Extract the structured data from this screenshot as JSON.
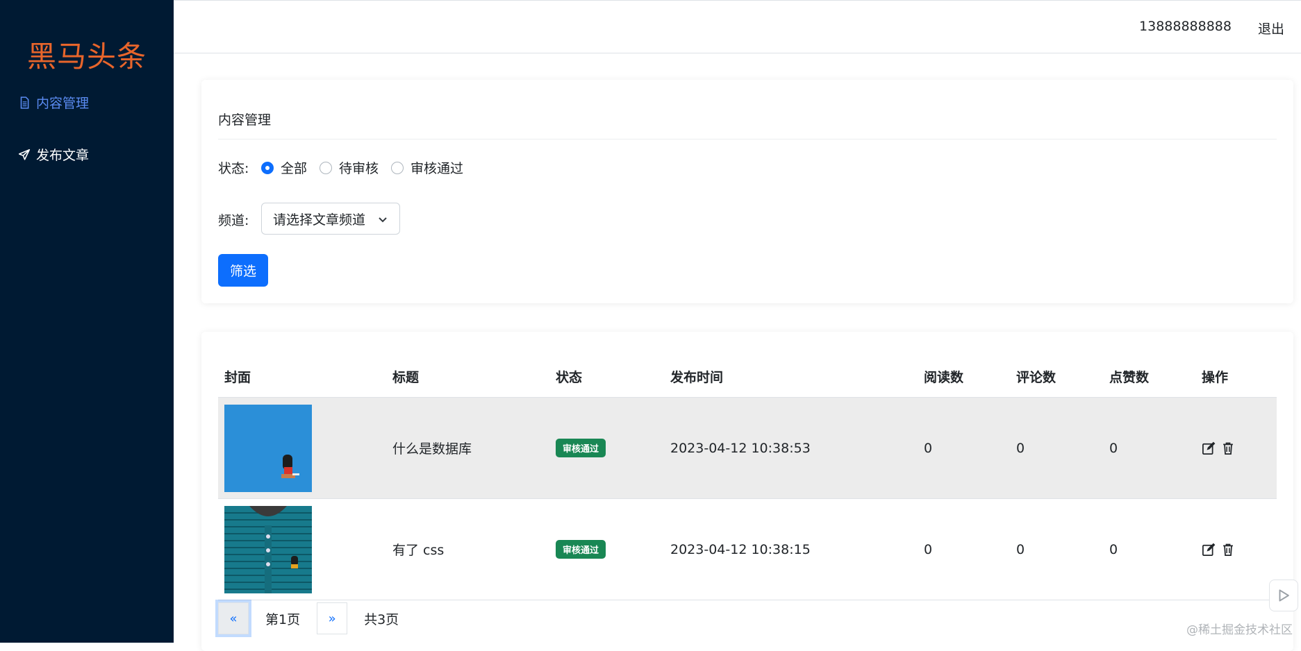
{
  "sidebar": {
    "logo": "黑马头条",
    "items": [
      {
        "label": "内容管理",
        "icon": "document-icon",
        "active": true
      },
      {
        "label": "发布文章",
        "icon": "send-icon",
        "active": false
      }
    ]
  },
  "topbar": {
    "phone": "13888888888",
    "logout": "退出"
  },
  "filter": {
    "title": "内容管理",
    "status_label": "状态:",
    "status_options": [
      {
        "label": "全部",
        "checked": true
      },
      {
        "label": "待审核",
        "checked": false
      },
      {
        "label": "审核通过",
        "checked": false
      }
    ],
    "channel_label": "频道:",
    "channel_select": "请选择文章频道",
    "submit_label": "筛选"
  },
  "table": {
    "headers": [
      "封面",
      "标题",
      "状态",
      "发布时间",
      "阅读数",
      "评论数",
      "点赞数",
      "操作"
    ],
    "rows": [
      {
        "title": "什么是数据库",
        "status": "审核通过",
        "time": "2023-04-12 10:38:53",
        "reads": "0",
        "comments": "0",
        "likes": "0",
        "cover": "blue-cover"
      },
      {
        "title": "有了 css",
        "status": "审核通过",
        "time": "2023-04-12 10:38:15",
        "reads": "0",
        "comments": "0",
        "likes": "0",
        "cover": "shirt-cover"
      }
    ]
  },
  "pagination": {
    "prev": "«",
    "page_text": "第1页",
    "next": "»",
    "total_text": "共3页"
  },
  "watermark": "@稀土掘金技术社区",
  "colors": {
    "sidebar_bg": "#001a33",
    "logo": "#e8652b",
    "accent": "#0d6efd",
    "badge": "#198754"
  }
}
